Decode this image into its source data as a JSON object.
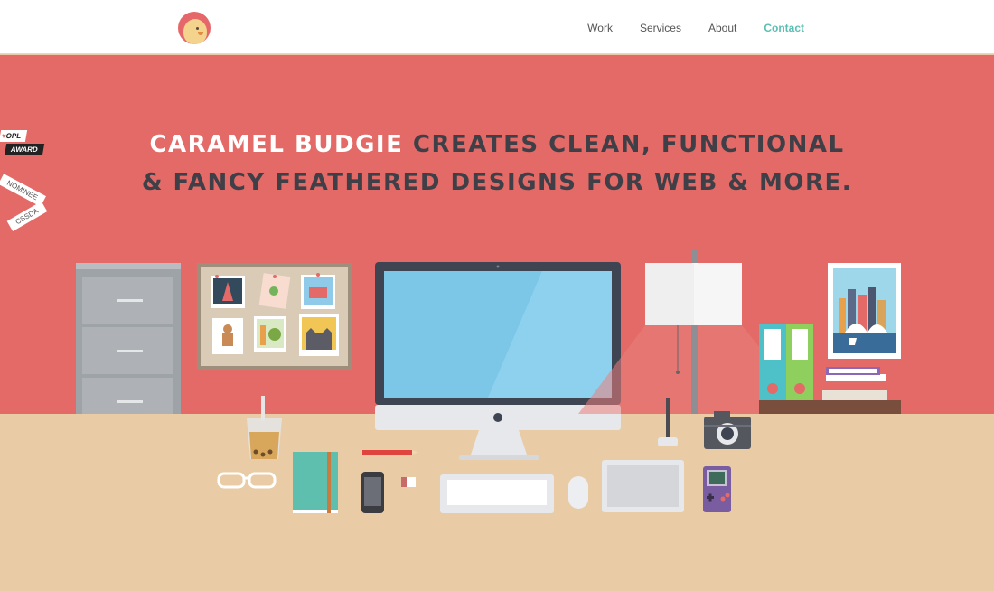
{
  "nav": {
    "items": [
      {
        "label": "Work"
      },
      {
        "label": "Services"
      },
      {
        "label": "About"
      },
      {
        "label": "Contact",
        "active": true
      }
    ]
  },
  "hero": {
    "brand": "CARAMEL BUDGIE",
    "line1_rest": " CREATES CLEAN, FUNCTIONAL",
    "line2": "& FANCY FEATHERED DESIGNS FOR WEB & MORE."
  },
  "badges": {
    "opl": "OPL",
    "award": "AWARD",
    "nominee": "NOMINEE",
    "cssda": "CSSDA"
  },
  "colors": {
    "wall": "#e36a67",
    "floor": "#e9cca6",
    "accent": "#5bbfb3",
    "text_dark": "#3f3f48"
  }
}
